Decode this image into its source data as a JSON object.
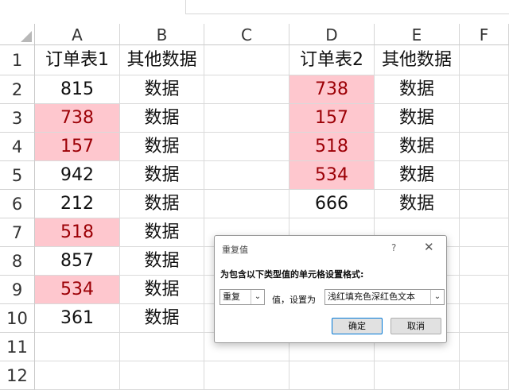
{
  "columns": [
    "A",
    "B",
    "C",
    "D",
    "E",
    "F"
  ],
  "rows": [
    "1",
    "2",
    "3",
    "4",
    "5",
    "6",
    "7",
    "8",
    "9",
    "10",
    "11",
    "12"
  ],
  "cells": {
    "A1": "订单表1",
    "B1": "其他数据",
    "D1": "订单表2",
    "E1": "其他数据",
    "A2": "815",
    "B2": "数据",
    "D2": "738",
    "E2": "数据",
    "A3": "738",
    "B3": "数据",
    "D3": "157",
    "E3": "数据",
    "A4": "157",
    "B4": "数据",
    "D4": "518",
    "E4": "数据",
    "A5": "942",
    "B5": "数据",
    "D5": "534",
    "E5": "数据",
    "A6": "212",
    "B6": "数据",
    "D6": "666",
    "E6": "数据",
    "A7": "518",
    "B7": "数据",
    "A8": "857",
    "B8": "数据",
    "A9": "534",
    "B9": "数据",
    "A10": "361",
    "B10": "数据"
  },
  "highlight": {
    "fill": "#fec7ce",
    "text": "#9c0006",
    "cells": [
      "A3",
      "A4",
      "A7",
      "A9",
      "D2",
      "D3",
      "D4",
      "D5"
    ]
  },
  "dialog": {
    "title": "重复值",
    "help": "?",
    "close": "✕",
    "instruction": "为包含以下类型值的单元格设置格式:",
    "type_value": "重复",
    "middle_text": "值，设置为",
    "format_value": "浅红填充色深红色文本",
    "dropdown_arrow": "⌄",
    "ok_label": "确定",
    "cancel_label": "取消"
  }
}
